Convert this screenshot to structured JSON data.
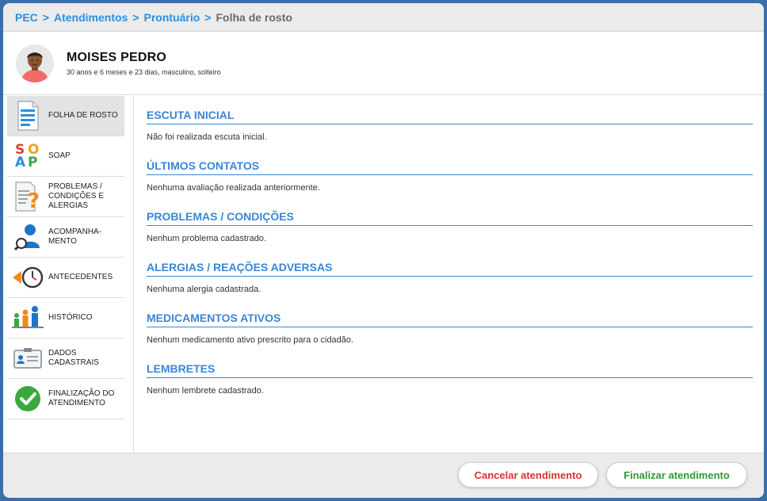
{
  "breadcrumb": {
    "items": [
      "PEC",
      "Atendimentos",
      "Prontuário"
    ],
    "separator": ">",
    "current": "Folha de rosto"
  },
  "patient": {
    "name": "MOISES PEDRO",
    "details": "30 anos e 6 meses e 23 dias, masculino, solteiro",
    "avatar_icon": "user-avatar-icon"
  },
  "sidebar": {
    "items": [
      {
        "label": "FOLHA DE ROSTO",
        "icon": "document-icon",
        "active": true
      },
      {
        "label": "SOAP",
        "icon": "soap-icon",
        "active": false
      },
      {
        "label": "PROBLEMAS / CONDIÇÕES E ALERGIAS",
        "icon": "problem-document-icon",
        "active": false
      },
      {
        "label": "ACOMPANHA- MENTO",
        "icon": "person-search-icon",
        "active": false
      },
      {
        "label": "ANTECEDENTES",
        "icon": "clock-back-icon",
        "active": false
      },
      {
        "label": "HISTÓRICO",
        "icon": "family-history-icon",
        "active": false
      },
      {
        "label": "DADOS CADASTRAIS",
        "icon": "id-card-icon",
        "active": false
      },
      {
        "label": "FINALIZAÇÃO DO ATENDIMENTO",
        "icon": "check-circle-icon",
        "active": false
      }
    ],
    "soap_letters": [
      "S",
      "O",
      "A",
      "P"
    ]
  },
  "sections": [
    {
      "title": "ESCUTA INICIAL",
      "text": "Não foi realizada escuta inicial."
    },
    {
      "title": "ÚLTIMOS CONTATOS",
      "text": "Nenhuma avaliação realizada anteriormente."
    },
    {
      "title": "PROBLEMAS / CONDIÇÕES",
      "text": "Nenhum problema cadastrado."
    },
    {
      "title": "ALERGIAS / REAÇÕES ADVERSAS",
      "text": "Nenhuma alergia cadastrada."
    },
    {
      "title": "MEDICAMENTOS ATIVOS",
      "text": "Nenhum medicamento ativo prescrito para o cidadão."
    },
    {
      "title": "LEMBRETES",
      "text": "Nenhum lembrete cadastrado."
    }
  ],
  "footer": {
    "cancel_label": "Cancelar atendimento",
    "finish_label": "Finalizar atendimento"
  },
  "colors": {
    "accent": "#3a86d6",
    "link": "#2a8fde",
    "cancel": "#d9322f",
    "finish": "#2f9a33",
    "frame": "#3b6ea5"
  }
}
